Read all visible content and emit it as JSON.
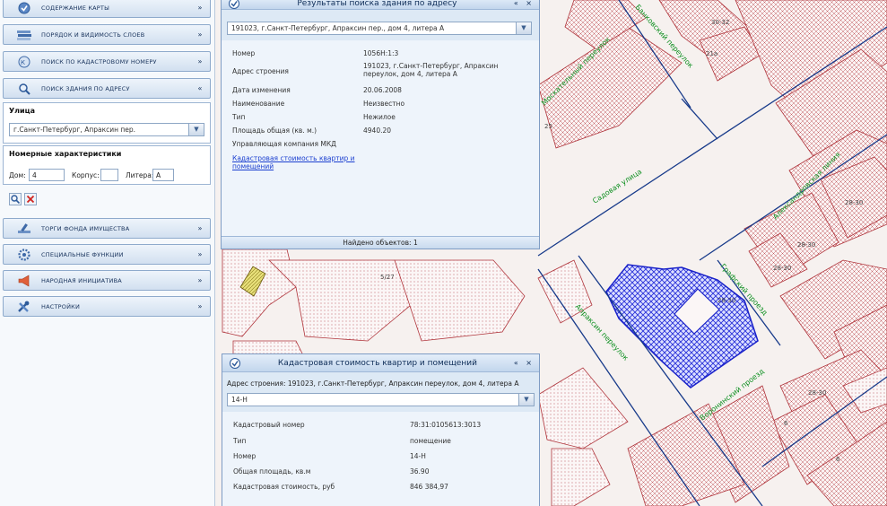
{
  "sidebar": {
    "accordions_top": [
      {
        "label": "Содержание карты",
        "icon": "map-content-icon",
        "chev": "»"
      },
      {
        "label": "Порядок и видимость слоев",
        "icon": "layers-icon",
        "chev": "»"
      },
      {
        "label": "Поиск по кадастровому номеру",
        "icon": "cadastral-search-icon",
        "chev": "»"
      },
      {
        "label": "Поиск здания по адресу",
        "icon": "building-search-icon",
        "chev": "«"
      }
    ],
    "street_section_title": "Улица",
    "street_value": "г.Санкт-Петербург, Апраксин пер.",
    "numbers_section_title": "Номерные характеристики",
    "house_label": "Дом:",
    "house_value": "4",
    "building_label": "Корпус:",
    "building_value": "",
    "letter_label": "Литера:",
    "letter_value": "А",
    "accordions_bottom": [
      {
        "label": "Торги фонда имущества",
        "icon": "auction-icon",
        "chev": "»"
      },
      {
        "label": "Специальные функции",
        "icon": "gear-icon",
        "chev": "»"
      },
      {
        "label": "Народная инициатива",
        "icon": "megaphone-icon",
        "chev": "»"
      },
      {
        "label": "Настройки",
        "icon": "tools-icon",
        "chev": "»"
      }
    ]
  },
  "search_window": {
    "title": "Результаты поиска здания по адресу",
    "tools": "« ×",
    "address_select": "191023, г.Санкт-Петербург, Апраксин пер., дом 4, литера А",
    "rows": [
      {
        "key": "Номер",
        "value": "1056Н:1:3"
      },
      {
        "key": "Адрес строения",
        "value": "191023, г.Санкт-Петербург, Апраксин переулок, дом 4, литера А"
      },
      {
        "key": "Дата изменения",
        "value": "20.06.2008"
      },
      {
        "key": "Наименование",
        "value": "Неизвестно"
      },
      {
        "key": "Тип",
        "value": "Нежилое"
      },
      {
        "key": "Площадь общая (кв. м.)",
        "value": "4940.20"
      },
      {
        "key": "Управляющая компания МКД",
        "value": ""
      }
    ],
    "link": "Кадастровая стоимость квартир и помещений",
    "footer": "Найдено объектов: 1"
  },
  "cadastral_window": {
    "title": "Кадастровая стоимость квартир и помещений",
    "tools": "« ×",
    "address_line": "Адрес строения: 191023, г.Санкт-Петербург, Апраксин переулок, дом 4, литера А",
    "unit_select": "14-Н",
    "rows": [
      {
        "key": "Кадастровый номер",
        "value": "78:31:0105613:3013"
      },
      {
        "key": "Тип",
        "value": "помещение"
      },
      {
        "key": "Номер",
        "value": "14-Н"
      },
      {
        "key": "Общая площадь, кв.м",
        "value": "36.90"
      },
      {
        "key": "Кадастровая стоимость, руб",
        "value": "846 384,97"
      }
    ]
  },
  "map": {
    "streets": [
      "Москательный переулок",
      "Банковский переулок",
      "Садовая улица",
      "Александровская линия",
      "Апраксин переулок",
      "Графский проезд",
      "Воронинский проезд"
    ],
    "labels": [
      "30-32",
      "21а",
      "25",
      "28-30",
      "28-30",
      "28-30",
      "28-30",
      "28-30",
      "6",
      "6",
      "5/27"
    ],
    "colors": {
      "street_text": "#0a8a1a",
      "building_fill": "#c1272d",
      "highlight": "#2830d8",
      "road_line": "#173a8a"
    }
  }
}
